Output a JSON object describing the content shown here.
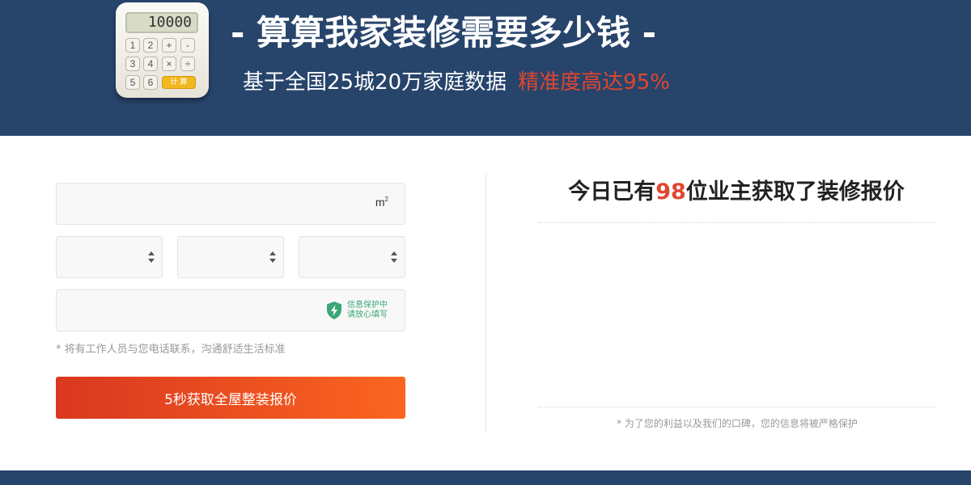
{
  "header": {
    "calculator": {
      "display": "10000",
      "keys": [
        "1",
        "2",
        "+",
        "-",
        "3",
        "4",
        "×",
        "÷",
        "5",
        "6"
      ],
      "go_label": "计 算"
    },
    "title": "- 算算我家装修需要多少钱 -",
    "subtitle": "基于全国25城20万家庭数据",
    "subtitle_accent": "精准度高达95%"
  },
  "form": {
    "area": {
      "value": "",
      "unit": "m",
      "unit_sup": "2"
    },
    "selects": [
      {
        "selected": ""
      },
      {
        "selected": ""
      },
      {
        "selected": ""
      }
    ],
    "phone": {
      "value": "",
      "secure_line1": "信息保护中",
      "secure_line2": "请放心填写"
    },
    "note": "* 将有工作人员与您电话联系，沟通舒适生活标准",
    "submit_label": "5秒获取全屋整装报价"
  },
  "right_panel": {
    "title_prefix": "今日已有",
    "count": "98",
    "title_suffix": "位业主获取了装修报价",
    "note": "* 为了您的利益以及我们的口碑，您的信息将被严格保护"
  },
  "colors": {
    "banner_bg": "#27446b",
    "accent": "#e0462f",
    "button_start": "#d9371f",
    "button_end": "#fb6520",
    "secure_green": "#3aa776"
  }
}
